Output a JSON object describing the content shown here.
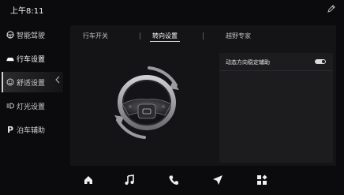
{
  "status": {
    "time": "上午8:11"
  },
  "sidebar": {
    "items": [
      {
        "label": "智能驾驶",
        "icon": "steering-wheel-icon"
      },
      {
        "label": "行车设置",
        "icon": "car-icon",
        "active": true
      },
      {
        "label": "舒适设置",
        "icon": "smiley-icon"
      },
      {
        "label": "灯光设置",
        "icon": "light-icon"
      },
      {
        "label": "泊车辅助",
        "icon": "parking-icon",
        "glyph": "P"
      }
    ]
  },
  "tabs": [
    {
      "label": "行车开关"
    },
    {
      "label": "转向设置",
      "active": true
    },
    {
      "label": "越野专家"
    }
  ],
  "setting": {
    "label": "动态方向稳定辅助",
    "enabled": true
  },
  "dock": {
    "items": [
      "home-icon",
      "music-icon",
      "phone-icon",
      "navigation-icon",
      "apps-icon"
    ]
  },
  "colors": {
    "background": "#0b0b0d",
    "panel": "#1c1c1f",
    "accent": "#ffffff"
  }
}
